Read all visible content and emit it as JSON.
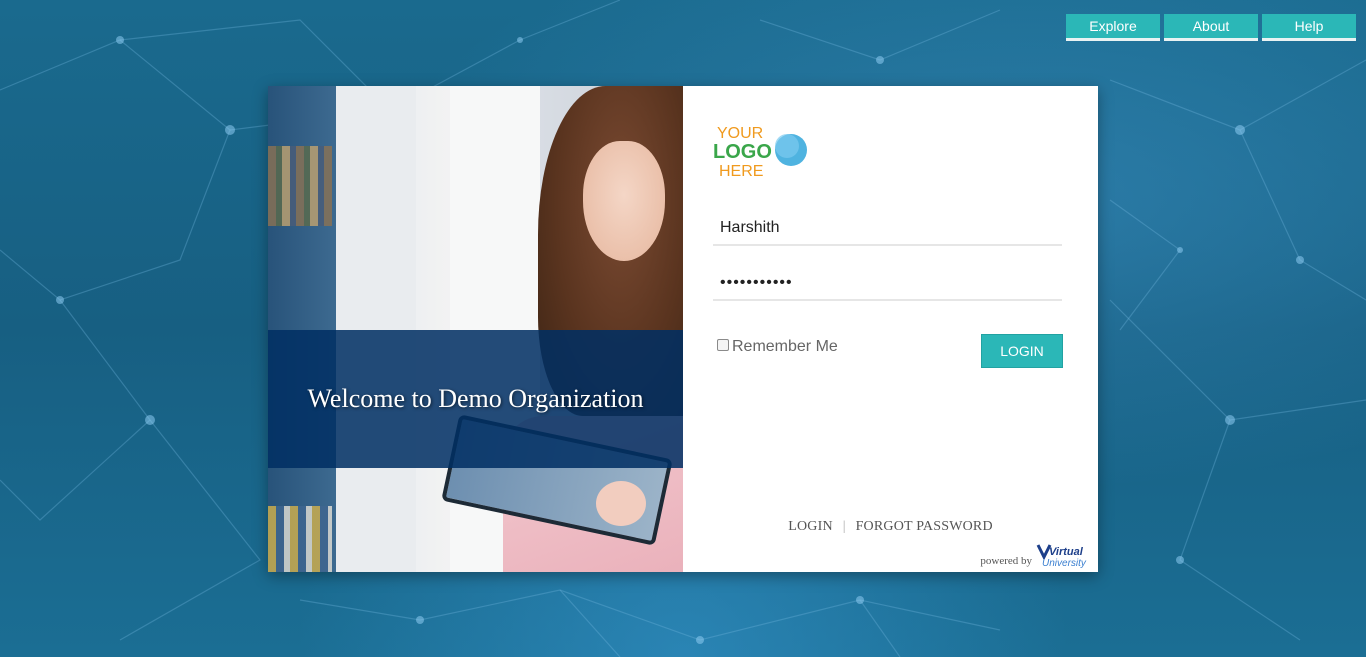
{
  "nav": {
    "explore_label": "Explore",
    "about_label": "About",
    "help_label": "Help"
  },
  "hero": {
    "welcome_text": "Welcome to Demo Organization"
  },
  "login": {
    "logo_text": [
      "YOUR",
      "LOGO",
      "HERE"
    ],
    "username_value": "Harshith",
    "password_value": "•••••••••••",
    "remember_label": "Remember Me",
    "remember_checked": false,
    "login_button_label": "LOGIN"
  },
  "footer": {
    "login_link": "LOGIN",
    "separator": "|",
    "forgot_link": "FORGOT PASSWORD",
    "powered_by": "powered by",
    "vu_logo_text": [
      "Virtual",
      "University"
    ]
  },
  "colors": {
    "accent": "#2bb7b7",
    "background": "#1a6a8e",
    "welcome_band": "#002e63"
  },
  "icons": [
    "network-background",
    "logo-placeholder",
    "virtual-university-logo",
    "checkbox"
  ]
}
